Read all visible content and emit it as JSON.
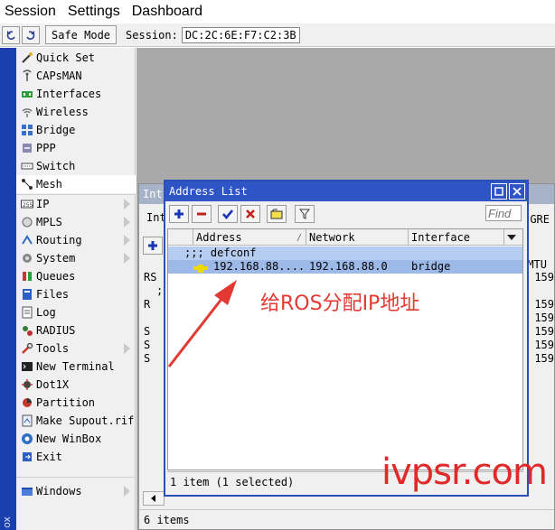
{
  "menubar": {
    "items": [
      "Session",
      "Settings",
      "Dashboard"
    ]
  },
  "toolbar": {
    "safe_mode_label": "Safe Mode",
    "session_label": "Session:",
    "session_value": "DC:2C:6E:F7:C2:3B"
  },
  "brand_strip": "ox",
  "sidebar": {
    "items": [
      {
        "label": "Quick Set",
        "icon": "wand-icon"
      },
      {
        "label": "CAPsMAN",
        "icon": "antenna-icon"
      },
      {
        "label": "Interfaces",
        "icon": "interfaces-icon"
      },
      {
        "label": "Wireless",
        "icon": "wireless-icon"
      },
      {
        "label": "Bridge",
        "icon": "bridge-icon"
      },
      {
        "label": "PPP",
        "icon": "ppp-icon"
      },
      {
        "label": "Switch",
        "icon": "switch-icon"
      },
      {
        "label": "Mesh",
        "icon": "mesh-icon"
      },
      {
        "label": "IP",
        "icon": "ip-icon",
        "submenu": true
      },
      {
        "label": "MPLS",
        "icon": "mpls-icon",
        "submenu": true
      },
      {
        "label": "Routing",
        "icon": "routing-icon",
        "submenu": true
      },
      {
        "label": "System",
        "icon": "system-icon",
        "submenu": true
      },
      {
        "label": "Queues",
        "icon": "queues-icon"
      },
      {
        "label": "Files",
        "icon": "files-icon"
      },
      {
        "label": "Log",
        "icon": "log-icon"
      },
      {
        "label": "RADIUS",
        "icon": "radius-icon"
      },
      {
        "label": "Tools",
        "icon": "tools-icon",
        "submenu": true
      },
      {
        "label": "New Terminal",
        "icon": "terminal-icon"
      },
      {
        "label": "Dot1X",
        "icon": "dot1x-icon"
      },
      {
        "label": "Partition",
        "icon": "partition-icon"
      },
      {
        "label": "Make Supout.rif",
        "icon": "supout-icon"
      },
      {
        "label": "New WinBox",
        "icon": "winbox-icon"
      },
      {
        "label": "Exit",
        "icon": "exit-icon"
      },
      {
        "label": "Windows",
        "icon": "windows-icon",
        "submenu": true
      }
    ]
  },
  "bg_window": {
    "title": "Int",
    "tab_left": "Int",
    "tab_right": "GRE",
    "mtu_header": "MTU",
    "row_flags": [
      "RS",
      ";",
      "R",
      "",
      "S",
      "S",
      "S"
    ],
    "row_mtu": [
      "159",
      "",
      "159",
      "159",
      "159",
      "159",
      "159"
    ],
    "status": "6 items"
  },
  "dialog": {
    "title": "Address List",
    "find_placeholder": "Find",
    "columns": [
      "Address",
      "Network",
      "Interface"
    ],
    "group_row": ";;; defconf",
    "rows": [
      {
        "address": "192.168.88....",
        "network": "192.168.88.0",
        "interface": "bridge"
      }
    ],
    "status": "1 item (1 selected)"
  },
  "annotation": "给ROS分配IP地址",
  "watermark": "ivpsr.com",
  "colors": {
    "strip_blue": "#1c3fb0",
    "dialog_title": "#2e54c6",
    "selected_row": "#9db9e8",
    "annotation_red": "#e23a32"
  }
}
